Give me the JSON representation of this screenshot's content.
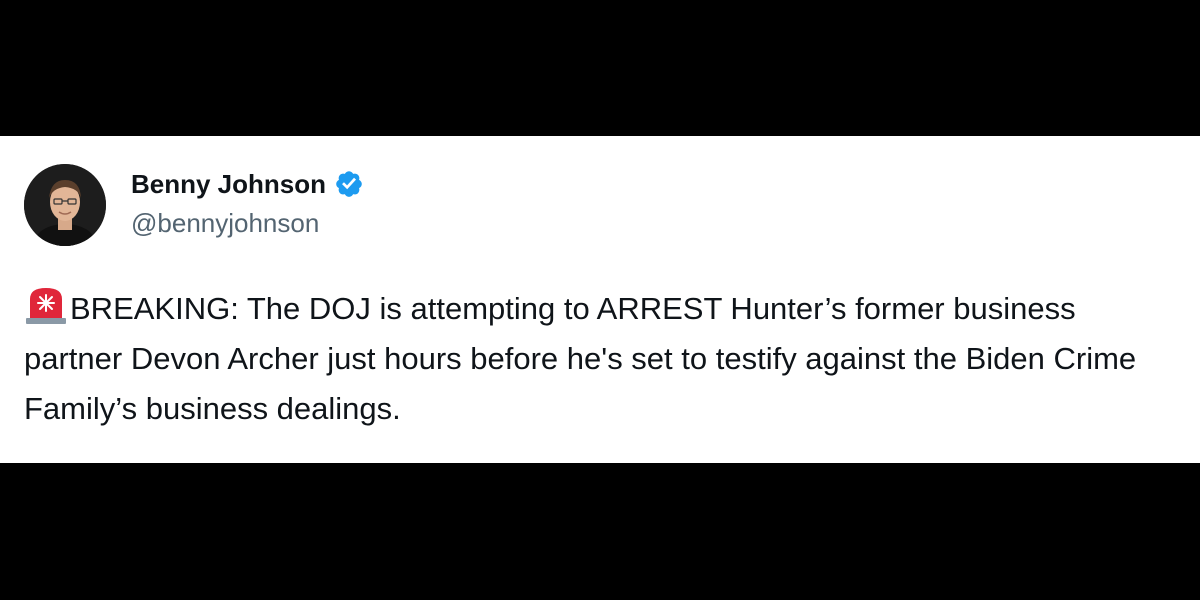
{
  "tweet": {
    "author": {
      "display_name": "Benny Johnson",
      "handle": "@bennyjohnson",
      "verified": true,
      "verified_color": "#1d9bf0",
      "avatar_icon": "profile-photo"
    },
    "text": {
      "emoji": "police-siren-icon",
      "body": "BREAKING: The DOJ is attempting to ARREST Hunter’s former business partner Devon Archer just hours before he's set to testify against the Biden Crime Family’s business dealings."
    }
  },
  "colors": {
    "background": "#000000",
    "card": "#ffffff",
    "text_primary": "#0f1419",
    "text_secondary": "#536471",
    "siren_red": "#e0263a"
  }
}
